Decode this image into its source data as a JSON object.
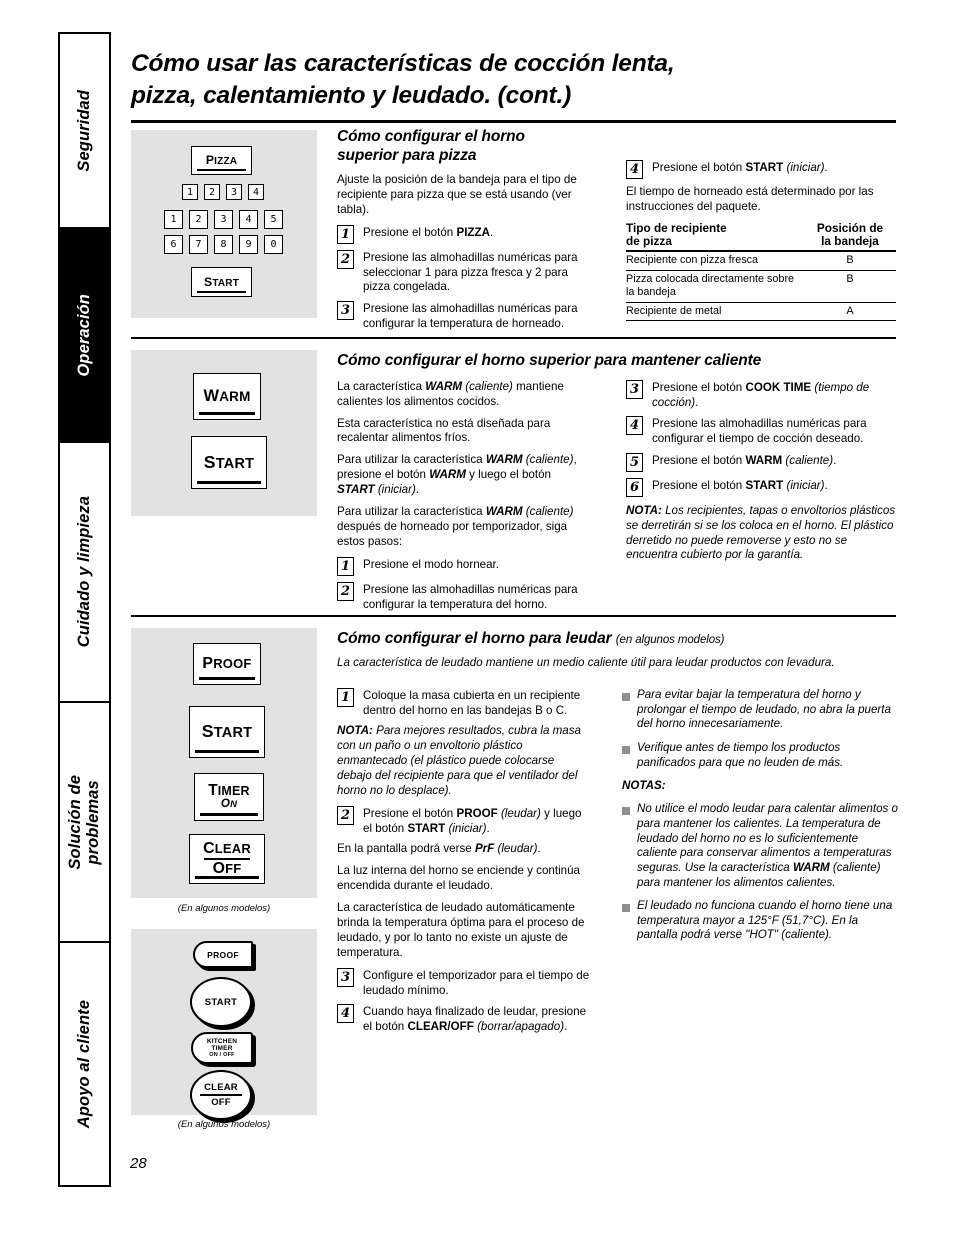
{
  "page_number": "28",
  "header": {
    "title_line1": "Cómo usar las características de cocción lenta,",
    "title_line2": "pizza, calentamiento y leudado. (cont.)"
  },
  "sidebar": {
    "items": [
      {
        "label": "Seguridad",
        "active": false
      },
      {
        "label": "Operación",
        "active": true
      },
      {
        "label": "Cuidado y limpieza",
        "active": false
      },
      {
        "label": "Solución de\nproblemas",
        "active": false
      },
      {
        "label": "Apoyo al cliente",
        "active": false
      }
    ]
  },
  "pizza_section": {
    "panel": {
      "pizza_button": "Pizza",
      "start_button": "Start",
      "row_small": [
        "1",
        "2",
        "3",
        "4"
      ],
      "row_a": [
        "1",
        "2",
        "3",
        "4",
        "5"
      ],
      "row_b": [
        "6",
        "7",
        "8",
        "9",
        "0"
      ]
    },
    "heading": "Cómo configurar el horno superior para pizza",
    "intro": "Ajuste la posición de la bandeja para el tipo de recipiente para pizza que se está usando (ver tabla).",
    "steps_left": [
      {
        "num": "1",
        "html": "Presione el botón <b>PIZZA</b>."
      },
      {
        "num": "2",
        "html": "Presione las almohadillas numéricas para seleccionar 1 para pizza fresca y 2 para pizza congelada."
      },
      {
        "num": "3",
        "html": "Presione las almohadillas numéricas para configurar la temperatura de horneado."
      }
    ],
    "steps_right": [
      {
        "num": "4",
        "html": "Presione el botón <b>START</b> <span class=\"it\">(iniciar)</span>."
      }
    ],
    "note_right": "El tiempo de horneado está determinado por las instrucciones del paquete.",
    "table": {
      "header_col1_line1": "Tipo de recipiente",
      "header_col1_line2": "de pizza",
      "header_col2_line1": "Posición de",
      "header_col2_line2": "la bandeja",
      "rows": [
        {
          "type": "Recipiente con pizza fresca",
          "position": "B"
        },
        {
          "type": "Pizza colocada directamente sobre la bandeja",
          "position": "B"
        },
        {
          "type": "Recipiente de metal",
          "position": "A"
        }
      ]
    }
  },
  "warm_section": {
    "panel": {
      "warm_button": "Warm",
      "start_button": "Start"
    },
    "heading": "Cómo configurar el horno superior para mantener caliente",
    "paragraphs": [
      "La característica <b>WARM</b> <span class=\"it\">(caliente)</span> mantiene calientes los alimentos cocidos.",
      "Esta característica no está diseñada para recalentar alimentos fríos.",
      "Para utilizar la característica <b>WARM</b> <span class=\"it\">(caliente)</span>, presione el botón <b>WARM</b> y luego el botón <b>START</b> <span class=\"it\">(iniciar)</span>.",
      "Para utilizar la característica <b>WARM</b> <span class=\"it\">(caliente)</span> después de horneado por temporizador, siga estos pasos:"
    ],
    "steps_left": [
      {
        "num": "1",
        "html": "Presione el modo hornear."
      },
      {
        "num": "2",
        "html": "Presione las almohadillas numéricas para configurar la temperatura del horno."
      }
    ],
    "steps_right": [
      {
        "num": "3",
        "html": "Presione el botón <b>COOK TIME</b> <span class=\"it\">(tiempo de cocción)</span>."
      },
      {
        "num": "4",
        "html": "Presione las almohadillas numéricas para configurar el tiempo de cocción deseado."
      },
      {
        "num": "5",
        "html": "Presione el botón <b>WARM</b> <span class=\"it\">(caliente)</span>."
      },
      {
        "num": "6",
        "html": "Presione el botón <b>START</b> <span class=\"it\">(iniciar)</span>."
      }
    ],
    "note": "<b>NOTA:</b> Los recipientes, tapas o envoltorios plásticos se derretirán si se los coloca en el horno. El plástico derretido no puede removerse y esto no se encuentra cubierto por la garantía."
  },
  "proof_section": {
    "panel_top": {
      "proof_button": "Proof",
      "start_button": "Start",
      "timer_button_line1": "Timer",
      "timer_button_line2": "On",
      "clear_button_line1": "Clear",
      "clear_button_line2": "Off",
      "caption": "(En algunos modelos)"
    },
    "panel_bottom": {
      "proof_button": "PROOF",
      "start_button": "START",
      "timer_line1": "KITCHEN",
      "timer_line2": "TIMER",
      "timer_line3": "ON / OFF",
      "clear_line1": "CLEAR",
      "clear_line2": "OFF",
      "caption": "(En algunos modelos)"
    },
    "heading": "Cómo configurar el horno para leudar",
    "heading_sub": "(en algunos modelos)",
    "intro": "La característica de leudado mantiene un medio caliente útil para leudar productos con levadura.",
    "steps_left_a": [
      {
        "num": "1",
        "html": "Coloque la masa cubierta en un recipiente dentro del horno en las bandejas B o C."
      }
    ],
    "note1": "<b>NOTA:</b> Para mejores resultados, cubra la masa con un paño o un envoltorio plástico enmantecado (el plástico puede colocarse debajo del recipiente para que el ventilador del horno no lo desplace).",
    "steps_left_b": [
      {
        "num": "2",
        "html": "Presione el botón <b>PROOF</b> <span class=\"it\">(leudar)</span> y luego el botón <b>START</b> <span class=\"it\">(iniciar)</span>."
      }
    ],
    "paragraphs": [
      "En la pantalla podrá verse <b>PrF</b> <span class=\"it\">(leudar)</span>.",
      "La luz interna del horno se enciende y continúa encendida durante el leudado.",
      "La característica de leudado automáticamente brinda la temperatura óptima para el proceso de leudado, y por lo tanto no existe un ajuste de temperatura."
    ],
    "steps_left_c": [
      {
        "num": "3",
        "html": "Configure el temporizador para el tiempo de leudado mínimo."
      },
      {
        "num": "4",
        "html": "Cuando haya finalizado de leudar, presione el botón <b>CLEAR/OFF</b> <span class=\"it\">(borrar/apagado)</span>."
      }
    ],
    "bullets_top": [
      "Para evitar bajar la temperatura del horno y prolongar el tiempo de leudado, no abra la puerta del horno innecesariamente.",
      "Verifique antes de tiempo los productos panificados para que no leuden de más."
    ],
    "notes_label": "NOTAS:",
    "bullets_notes": [
      "No utilice el modo leudar para calentar alimentos o para mantener los calientes. La temperatura de leudado del horno no es lo suficientemente caliente para conservar alimentos a temperaturas seguras. Use la característica <b>WARM</b> (caliente) para mantener los alimentos calientes.",
      "El leudado no funciona cuando el horno tiene una temperatura mayor a 125°F (51,7°C). En la pantalla podrá verse \"HOT\" (caliente)."
    ]
  }
}
